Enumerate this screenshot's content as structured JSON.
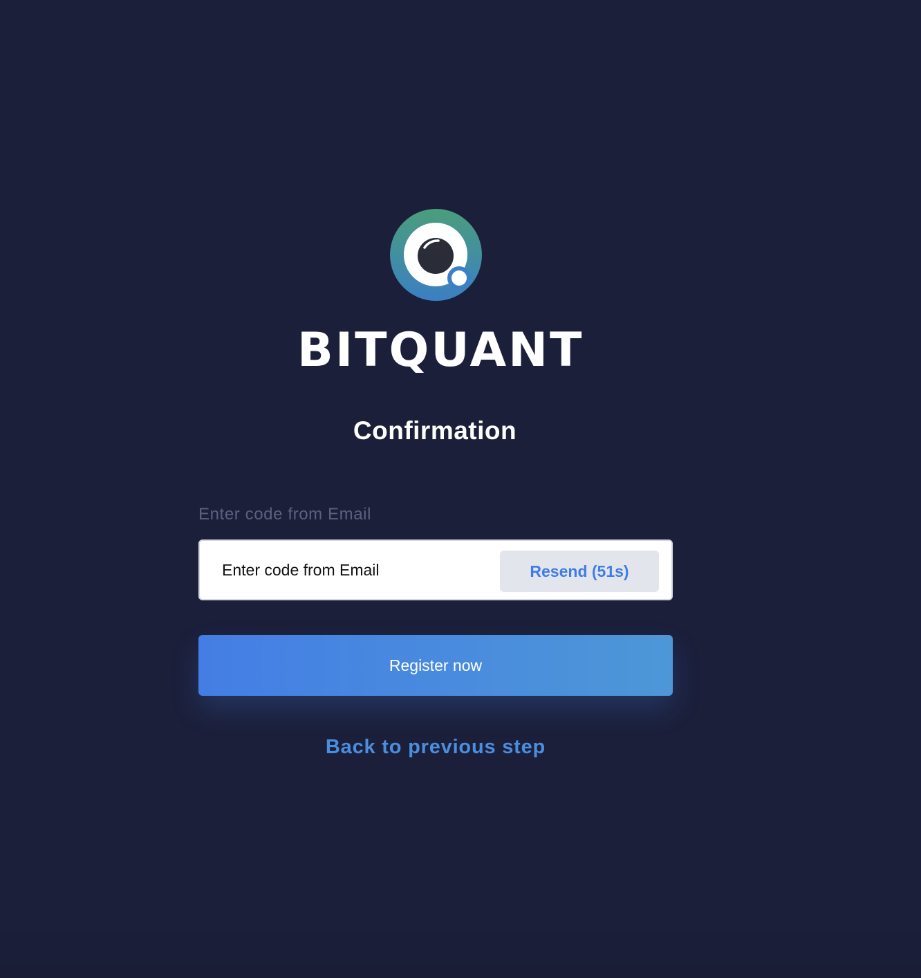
{
  "brand": {
    "name": "BITQUANT",
    "logo_icon": "bitquant-logo-icon",
    "gradient_top": "#4a9e7c",
    "gradient_bottom": "#3b7fc4"
  },
  "page": {
    "title": "Confirmation",
    "background": "#1b1f3a"
  },
  "code_field": {
    "label": "Enter code from Email",
    "placeholder": "Enter code from Email",
    "value": "",
    "resend_label": "Resend (51s)"
  },
  "actions": {
    "register_label": "Register now",
    "back_label": "Back to previous step",
    "accent": "#447ee5"
  }
}
